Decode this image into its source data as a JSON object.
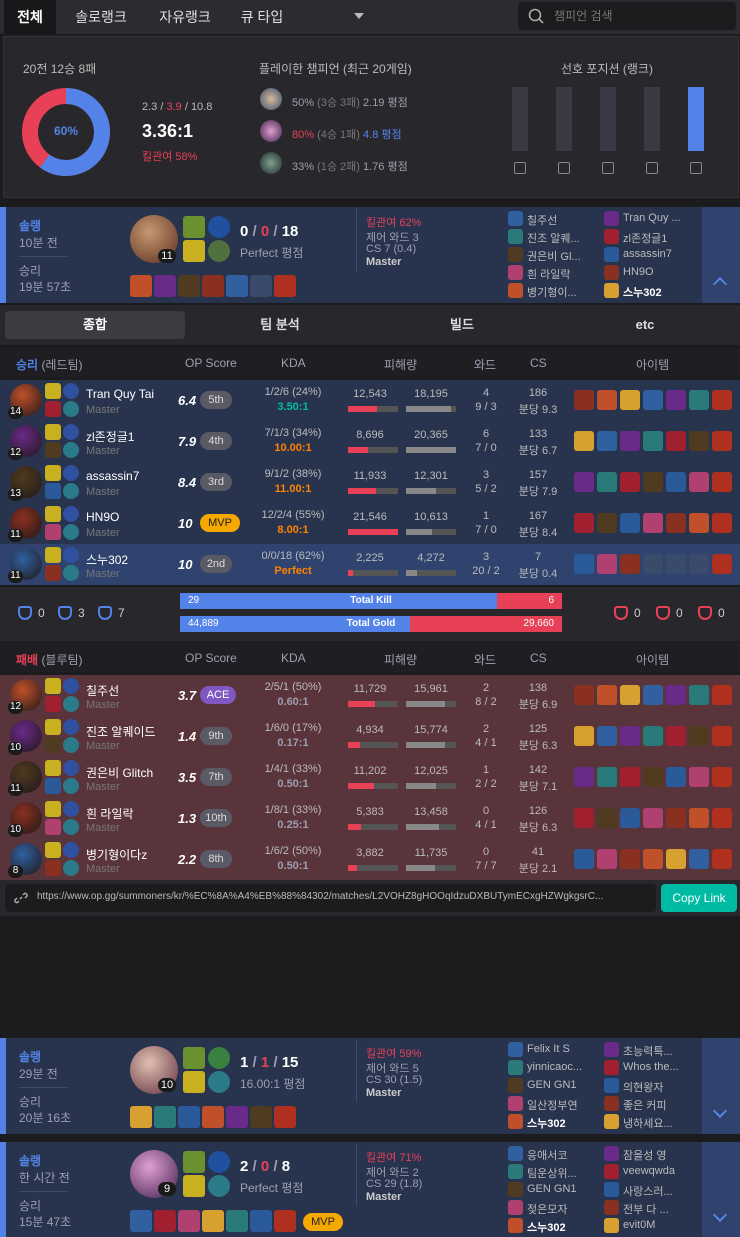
{
  "tabs": [
    "전체",
    "솔로랭크",
    "자유랭크",
    "큐 타입"
  ],
  "search": {
    "placeholder": "챔피언 검색"
  },
  "summary": {
    "record": "20전 12승 8패",
    "winrate": "60%",
    "kda_k": "2.3",
    "kda_sep": " / ",
    "kda_d": "3.9",
    "kda_a": "10.8",
    "kda_ratio": "3.36:1",
    "kill_participation": "킬관여 58%",
    "champ_title": "플레이한 챔피언 (최근 20게임)",
    "champs": [
      {
        "pct": "50%",
        "rec": "(3승 3패)",
        "score": "2.19 평점"
      },
      {
        "pct": "80%",
        "rec": "(4승 1패)",
        "score": "4.8 평점"
      },
      {
        "pct": "33%",
        "rec": "(1승 2패)",
        "score": "1.76 평점"
      }
    ],
    "pos_title": "선호 포지션 (랭크)",
    "positions": [
      0,
      0,
      0,
      0,
      1.0
    ]
  },
  "game1": {
    "type": "솔랭",
    "ago": "10분 전",
    "result": "승리",
    "duration": "19분 57초",
    "level": "11",
    "k": "0",
    "d": "0",
    "a": "18",
    "score": "Perfect 평점",
    "kp": "킬관여 62%",
    "wards": "제어 와드 3",
    "cs": "CS 7 (0.4)",
    "tier": "Master",
    "team1": [
      "칠주선",
      "진조 알퀘...",
      "권은비 Gl...",
      "흰 라일락",
      "병기형이..."
    ],
    "team2": [
      "Tran Quy ...",
      "zl존정글1",
      "assassin7",
      "HN9O",
      "스누302"
    ]
  },
  "detail_tabs": [
    "종합",
    "팀 분석",
    "빌드",
    "etc"
  ],
  "win_header": {
    "result": "승리",
    "team": "(레드팀)",
    "cols": [
      "OP Score",
      "KDA",
      "피해량",
      "와드",
      "CS",
      "아이템"
    ]
  },
  "win_rows": [
    {
      "lvl": "14",
      "name": "Tran Quy Tai",
      "tier": "Master",
      "op": "6.4",
      "rank": "5th",
      "kda": "1/2/6 (24%)",
      "ratio": "3.50:1",
      "dmg": "12,543",
      "taken": "18,195",
      "w1": "4",
      "w2": "9 / 3",
      "cs": "186",
      "cspm": "분당 9.3",
      "dfrac": 0.58,
      "tfrac": 0.89
    },
    {
      "lvl": "12",
      "name": "zl존정글1",
      "tier": "Master",
      "op": "7.9",
      "rank": "4th",
      "kda": "7/1/3 (34%)",
      "ratio": "10.00:1",
      "dmg": "8,696",
      "taken": "20,365",
      "w1": "6",
      "w2": "7 / 0",
      "cs": "133",
      "cspm": "분당 6.7",
      "dfrac": 0.4,
      "tfrac": 1.0
    },
    {
      "lvl": "13",
      "name": "assassin7",
      "tier": "Master",
      "op": "8.4",
      "rank": "3rd",
      "kda": "9/1/2 (38%)",
      "ratio": "11.00:1",
      "dmg": "11,933",
      "taken": "12,301",
      "w1": "3",
      "w2": "5 / 2",
      "cs": "157",
      "cspm": "분당 7.9",
      "dfrac": 0.55,
      "tfrac": 0.6
    },
    {
      "lvl": "11",
      "name": "HN9O",
      "tier": "Master",
      "op": "10",
      "rank": "MVP",
      "kda": "12/2/4 (55%)",
      "ratio": "8.00:1",
      "dmg": "21,546",
      "taken": "10,613",
      "w1": "1",
      "w2": "7 / 0",
      "cs": "167",
      "cspm": "분당 8.4",
      "dfrac": 1.0,
      "tfrac": 0.52
    },
    {
      "lvl": "11",
      "name": "스누302",
      "tier": "Master",
      "op": "10",
      "rank": "2nd",
      "kda": "0/0/18 (62%)",
      "ratio": "Perfect",
      "dmg": "2,225",
      "taken": "4,272",
      "w1": "3",
      "w2": "20 / 2",
      "cs": "7",
      "cspm": "분당 0.4",
      "dfrac": 0.1,
      "tfrac": 0.21
    }
  ],
  "objectives": {
    "left": [
      "0",
      "3",
      "7"
    ],
    "right": [
      "0",
      "0",
      "0"
    ],
    "kill_l": "29",
    "kill_label": "Total Kill",
    "kill_r": "6",
    "gold_l": "44,889",
    "gold_label": "Total Gold",
    "gold_r": "29,660",
    "kill_frac": 0.829,
    "gold_frac": 0.602
  },
  "lose_header": {
    "result": "패배",
    "team": "(블루팀)",
    "cols": [
      "OP Score",
      "KDA",
      "피해량",
      "와드",
      "CS",
      "아이템"
    ]
  },
  "lose_rows": [
    {
      "lvl": "12",
      "name": "칠주선",
      "tier": "Master",
      "op": "3.7",
      "rank": "ACE",
      "kda": "2/5/1 (50%)",
      "ratio": "0.60:1",
      "dmg": "11,729",
      "taken": "15,961",
      "w1": "2",
      "w2": "8 / 2",
      "cs": "138",
      "cspm": "분당 6.9",
      "dfrac": 0.54,
      "tfrac": 0.78
    },
    {
      "lvl": "10",
      "name": "진조 알퀘이드",
      "tier": "Master",
      "op": "1.4",
      "rank": "9th",
      "kda": "1/6/0 (17%)",
      "ratio": "0.17:1",
      "dmg": "4,934",
      "taken": "15,774",
      "w1": "2",
      "w2": "4 / 1",
      "cs": "125",
      "cspm": "분당 6.3",
      "dfrac": 0.23,
      "tfrac": 0.77
    },
    {
      "lvl": "11",
      "name": "권은비 Glitch",
      "tier": "Master",
      "op": "3.5",
      "rank": "7th",
      "kda": "1/4/1 (33%)",
      "ratio": "0.50:1",
      "dmg": "11,202",
      "taken": "12,025",
      "w1": "1",
      "w2": "2 / 2",
      "cs": "142",
      "cspm": "분당 7.1",
      "dfrac": 0.52,
      "tfrac": 0.59
    },
    {
      "lvl": "10",
      "name": "흰 라일락",
      "tier": "Master",
      "op": "1.3",
      "rank": "10th",
      "kda": "1/8/1 (33%)",
      "ratio": "0.25:1",
      "dmg": "5,383",
      "taken": "13,458",
      "w1": "0",
      "w2": "4 / 1",
      "cs": "126",
      "cspm": "분당 6.3",
      "dfrac": 0.25,
      "tfrac": 0.66
    },
    {
      "lvl": "8",
      "name": "병기형이다z",
      "tier": "Master",
      "op": "2.2",
      "rank": "8th",
      "kda": "1/6/2 (50%)",
      "ratio": "0.50:1",
      "dmg": "3,882",
      "taken": "11,735",
      "w1": "0",
      "w2": "7 / 7",
      "cs": "41",
      "cspm": "분당 2.1",
      "dfrac": 0.18,
      "tfrac": 0.58
    }
  ],
  "share": {
    "url": "https://www.op.gg/summoners/kr/%EC%8A%A4%EB%88%84302/matches/L2VOHZ8gHOOqIdzuDXBUTymECxgHZWgkgsrC...",
    "copy": "Copy Link"
  },
  "game2": {
    "type": "솔랭",
    "ago": "29분 전",
    "result": "승리",
    "duration": "20분 16초",
    "level": "10",
    "k": "1",
    "d": "1",
    "a": "15",
    "score": "16.00:1 평점",
    "kp": "킬관여 59%",
    "wards": "제어 와드 5",
    "cs": "CS 30 (1.5)",
    "tier": "Master",
    "team1": [
      "Felix It S",
      "yinnicaoc...",
      "GEN GN1",
      "일산정부연",
      "스누302"
    ],
    "team2": [
      "초능력특...",
      "Whos the...",
      "의현왕자",
      "좋은 커피",
      "냉하세요..."
    ]
  },
  "game3": {
    "type": "솔랭",
    "ago": "한 시간 전",
    "result": "승리",
    "duration": "15분 47초",
    "level": "9",
    "k": "2",
    "d": "0",
    "a": "8",
    "score": "Perfect 평점",
    "kp": "킬관여 71%",
    "wards": "제어 와드 2",
    "cs": "CS 29 (1.8)",
    "tier": "Master",
    "mvp": "MVP",
    "team1": [
      "응애서코",
      "팀운상위...",
      "GEN GN1",
      "젖은모자",
      "스누302"
    ],
    "team2": [
      "잠을성 영",
      "veewqwda",
      "사랑스러...",
      "전부 다 ...",
      "evit0M"
    ]
  },
  "colors": {
    "blue": "#5383e8",
    "red": "#e84057",
    "win_bg": "#28344e",
    "lose_bg": "#59343b",
    "mvp": "#f4a800",
    "ace": "#7e57c2"
  }
}
